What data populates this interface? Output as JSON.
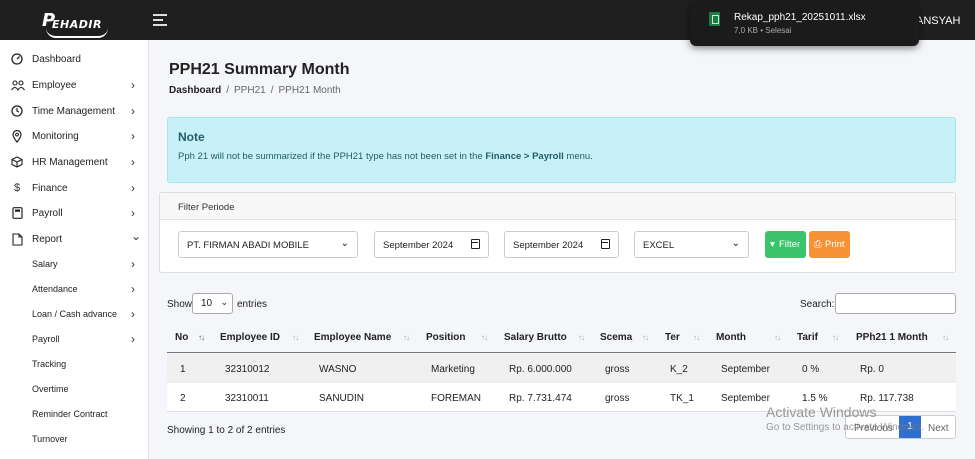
{
  "app": {
    "logo_text": "EHADIR",
    "logo_letter": "P",
    "user": "ANSYAH"
  },
  "download": {
    "filename": "Rekap_pph21_20251011.xlsx",
    "meta": "7,0 KB • Selesai"
  },
  "sidebar": {
    "items": [
      {
        "label": "Dashboard",
        "icon": "dashboard-icon",
        "arrow": ""
      },
      {
        "label": "Employee",
        "icon": "users-icon",
        "arrow": "›"
      },
      {
        "label": "Time Management",
        "icon": "clock-icon",
        "arrow": "›"
      },
      {
        "label": "Monitoring",
        "icon": "map-pin-icon",
        "arrow": "›"
      },
      {
        "label": "HR Management",
        "icon": "box-icon",
        "arrow": "›"
      },
      {
        "label": "Finance",
        "icon": "dollar-icon",
        "arrow": "›"
      },
      {
        "label": "Payroll",
        "icon": "calculator-icon",
        "arrow": "›"
      },
      {
        "label": "Report",
        "icon": "file-icon",
        "arrow": "⌄"
      }
    ],
    "sub_items": [
      {
        "label": "Salary",
        "arrow": "›"
      },
      {
        "label": "Attendance",
        "arrow": "›"
      },
      {
        "label": "Loan / Cash advance",
        "arrow": "›"
      },
      {
        "label": "Payroll",
        "arrow": "›"
      },
      {
        "label": "Tracking",
        "arrow": ""
      },
      {
        "label": "Overtime",
        "arrow": ""
      },
      {
        "label": "Reminder Contract",
        "arrow": ""
      },
      {
        "label": "Turnover",
        "arrow": ""
      }
    ]
  },
  "page": {
    "title": "PPH21 Summary Month",
    "breadcrumb": [
      "Dashboard",
      "PPH21",
      "PPH21 Month"
    ],
    "separator": "/"
  },
  "note": {
    "title": "Note",
    "text_before": "Pph 21 will not be summarized if the PPH21 type has not been set in the ",
    "text_bold": "Finance > Payroll",
    "text_after": " menu."
  },
  "filter": {
    "header": "Filter Periode",
    "company": "PT. FIRMAN ABADI MOBILE",
    "start_month": "September 2024",
    "end_month": "September 2024",
    "format": "EXCEL",
    "filter_label": "Filter",
    "print_label": "Print"
  },
  "table": {
    "show_label": "Show",
    "page_size": "10",
    "entries_label": "entries",
    "search_label": "Search:",
    "columns": [
      "No",
      "Employee ID",
      "Employee Name",
      "Position",
      "Salary Brutto",
      "Scema",
      "Ter",
      "Month",
      "Tarif",
      "PPh21 1 Month"
    ],
    "rows": [
      [
        "1",
        "32310012",
        "WASNO",
        "Marketing",
        "Rp. 6.000.000",
        "gross",
        "K_2",
        "September",
        "0 %",
        "Rp. 0"
      ],
      [
        "2",
        "32310011",
        "SANUDIN",
        "FOREMAN",
        "Rp. 7.731.474",
        "gross",
        "TK_1",
        "September",
        "1.5 %",
        "Rp. 117.738"
      ]
    ],
    "showing": "Showing 1 to 2 of 2 entries",
    "pager": {
      "prev": "Previous",
      "current": "1",
      "next": "Next"
    }
  },
  "watermark": {
    "line1": "Activate Windows",
    "line2": "Go to Settings to activate Windows."
  },
  "colors": {
    "accent": "#2f6fd1",
    "filter_btn": "#3bc46c",
    "print_btn": "#f79337",
    "note_bg": "#c8f1f7"
  }
}
